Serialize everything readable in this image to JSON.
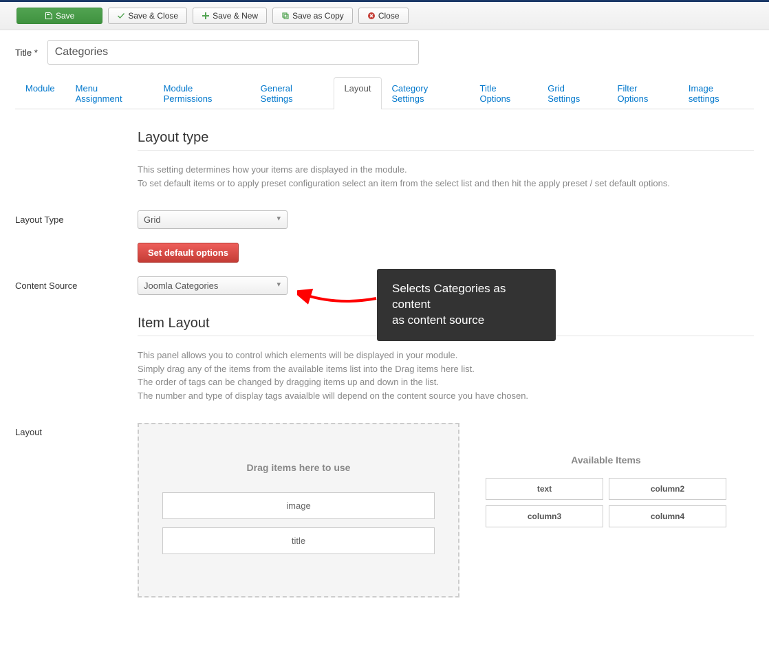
{
  "toolbar": {
    "save": "Save",
    "save_close": "Save & Close",
    "save_new": "Save & New",
    "save_copy": "Save as Copy",
    "close": "Close"
  },
  "title": {
    "label": "Title *",
    "value": "Categories"
  },
  "tabs": [
    "Module",
    "Menu Assignment",
    "Module Permissions",
    "General Settings",
    "Layout",
    "Category Settings",
    "Title Options",
    "Grid Settings",
    "Filter Options",
    "Image settings"
  ],
  "active_tab": "Layout",
  "layout_type_section": {
    "heading": "Layout type",
    "desc1": "This setting determines how your items are displayed in the module.",
    "desc2": "To set default items or to apply preset configuration select an item from the select list and then hit the apply preset / set default options."
  },
  "fields": {
    "layout_type_label": "Layout Type",
    "layout_type_value": "Grid",
    "set_default": "Set default options",
    "content_source_label": "Content Source",
    "content_source_value": "Joomla Categories",
    "layout_label": "Layout"
  },
  "item_layout_section": {
    "heading": "Item Layout",
    "desc1": "This panel allows you to control which elements will be displayed in your module.",
    "desc2": "Simply drag any of the items from the available items list into the Drag items here list.",
    "desc3": "The order of tags can be changed by dragging items up and down in the list.",
    "desc4": "The number and type of display tags avaialble will depend on the content source you have chosen."
  },
  "drop_zone": {
    "title": "Drag items here to use",
    "items": [
      "image",
      "title"
    ]
  },
  "available": {
    "title": "Available Items",
    "items": [
      "text",
      "column2",
      "column3",
      "column4"
    ]
  },
  "callout": {
    "line1": "Selects Categories as content",
    "line2": "as content source"
  }
}
